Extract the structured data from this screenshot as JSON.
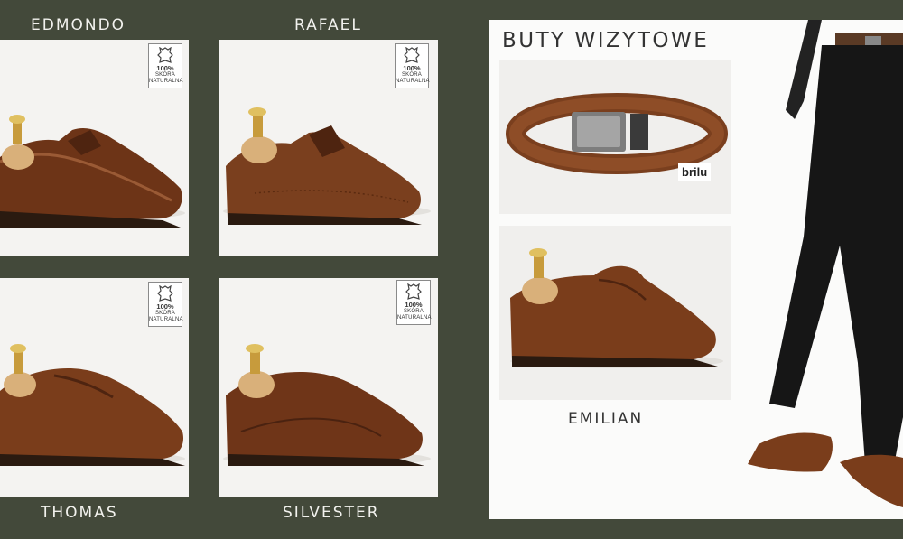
{
  "products": [
    {
      "name": "EDMONDO",
      "badge": {
        "pct": "100%",
        "line1": "SKÓRA",
        "line2": "NATURALNA"
      }
    },
    {
      "name": "RAFAEL",
      "badge": {
        "pct": "100%",
        "line1": "SKÓRA",
        "line2": "NATURALNA"
      }
    },
    {
      "name": "THOMAS",
      "badge": {
        "pct": "100%",
        "line1": "SKÓRA",
        "line2": "NATURALNA"
      }
    },
    {
      "name": "SILVESTER",
      "badge": {
        "pct": "100%",
        "line1": "SKÓRA",
        "line2": "NATURALNA"
      }
    }
  ],
  "featured": {
    "heading": "BUTY WIZYTOWE",
    "belt_brand": "brilu",
    "shoe_name": "EMILIAN"
  },
  "colors": {
    "background": "#43493a",
    "leather": "#7a3f1e",
    "card": "#f4f3f1"
  },
  "icons": [
    "leather-hide-icon",
    "shoe-tree-icon"
  ]
}
